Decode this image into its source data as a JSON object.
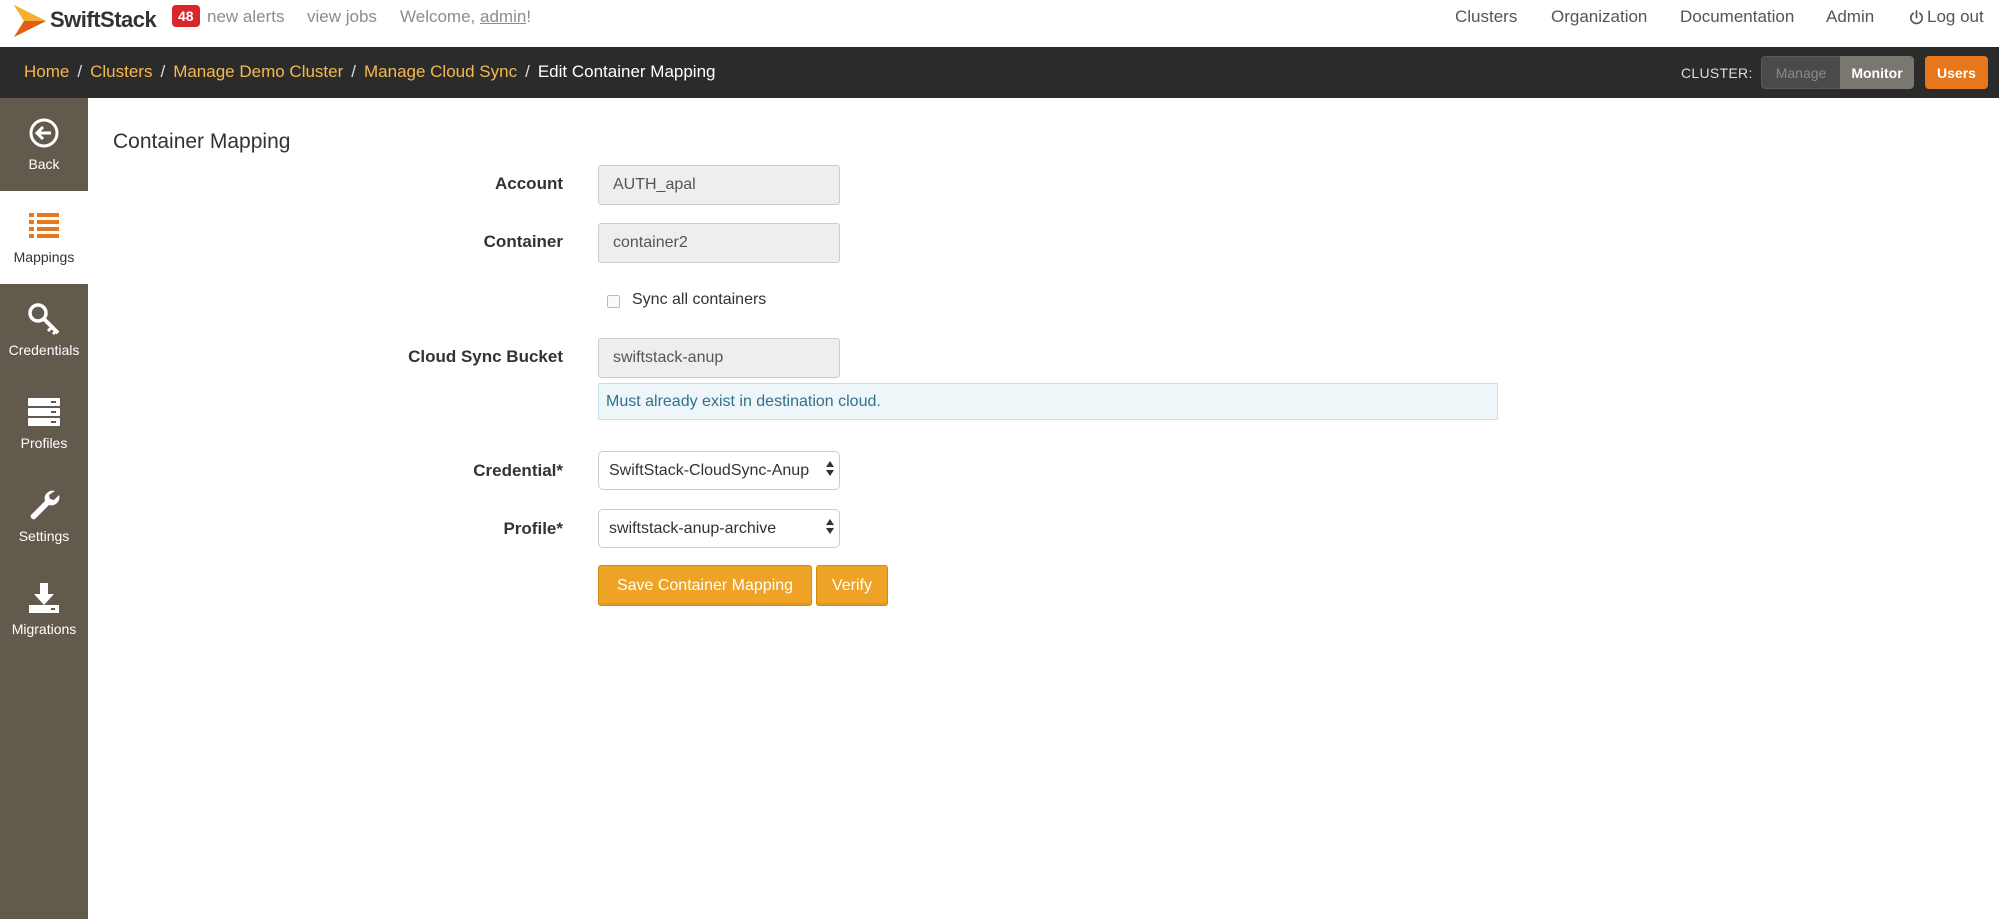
{
  "header": {
    "brand": "SwiftStack",
    "alert_count": "48",
    "alerts_label": "new alerts",
    "view_jobs": "view jobs",
    "welcome_prefix": "Welcome, ",
    "username": "admin",
    "welcome_suffix": "!",
    "nav": [
      "Clusters",
      "Organization",
      "Documentation",
      "Admin",
      "Log out"
    ]
  },
  "breadcrumb": {
    "items": [
      "Home",
      "Clusters",
      "Manage Demo Cluster",
      "Manage Cloud Sync"
    ],
    "current": "Edit Container Mapping",
    "separator": "/"
  },
  "cluster_toggle": {
    "label": "CLUSTER:",
    "manage": "Manage",
    "monitor": "Monitor",
    "users": "Users"
  },
  "sidebar": {
    "items": [
      {
        "label": "Back",
        "icon": "back-circle-icon"
      },
      {
        "label": "Mappings",
        "icon": "list-icon",
        "active": true
      },
      {
        "label": "Credentials",
        "icon": "key-icon"
      },
      {
        "label": "Profiles",
        "icon": "server-stack-icon"
      },
      {
        "label": "Settings",
        "icon": "wrench-icon"
      },
      {
        "label": "Migrations",
        "icon": "download-icon"
      }
    ]
  },
  "form": {
    "title": "Container Mapping",
    "account_label": "Account",
    "account_value": "AUTH_apal",
    "container_label": "Container",
    "container_value": "container2",
    "sync_all_label": "Sync all containers",
    "bucket_label": "Cloud Sync Bucket",
    "bucket_value": "swiftstack-anup",
    "bucket_help": "Must already exist in destination cloud.",
    "credential_label": "Credential*",
    "credential_value": "SwiftStack-CloudSync-Anup",
    "profile_label": "Profile*",
    "profile_value": "swiftstack-anup-archive",
    "save_button": "Save Container Mapping",
    "verify_button": "Verify"
  },
  "colors": {
    "accent_orange": "#eea326",
    "breadcrumb_link": "#f5b94d",
    "sidebar_bg": "#625a4c",
    "alert_red": "#d9262b"
  }
}
